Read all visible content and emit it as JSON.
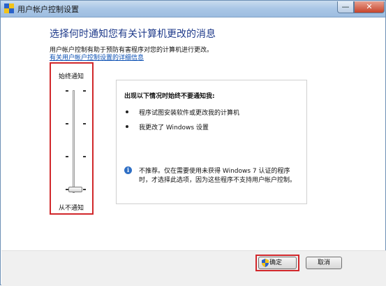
{
  "window": {
    "title": "用户帐户控制设置",
    "controls": {
      "minimize": "—",
      "close": "✕"
    }
  },
  "content": {
    "heading": "选择何时通知您有关计算机更改的消息",
    "description": "用户帐户控制有助于预防有害程序对您的计算机进行更改。",
    "link": "有关用户帐户控制设置的详细信息"
  },
  "slider": {
    "top_label": "始终通知",
    "bottom_label": "从不通知",
    "levels": 4,
    "current_level": 1
  },
  "info": {
    "title": "出现以下情况时始终不要通知我:",
    "bullets": [
      "程序试图安装软件或更改我的计算机",
      "我更改了 Windows 设置"
    ],
    "note": "不推荐。仅在需要使用未获得 Windows 7 认证的程序时，才选择此选项，因为这些程序不支持用户帐户控制。"
  },
  "buttons": {
    "ok": "确定",
    "cancel": "取消"
  },
  "colors": {
    "heading": "#1e3a8a",
    "link": "#0b4fb3",
    "highlight": "#d1272b"
  }
}
